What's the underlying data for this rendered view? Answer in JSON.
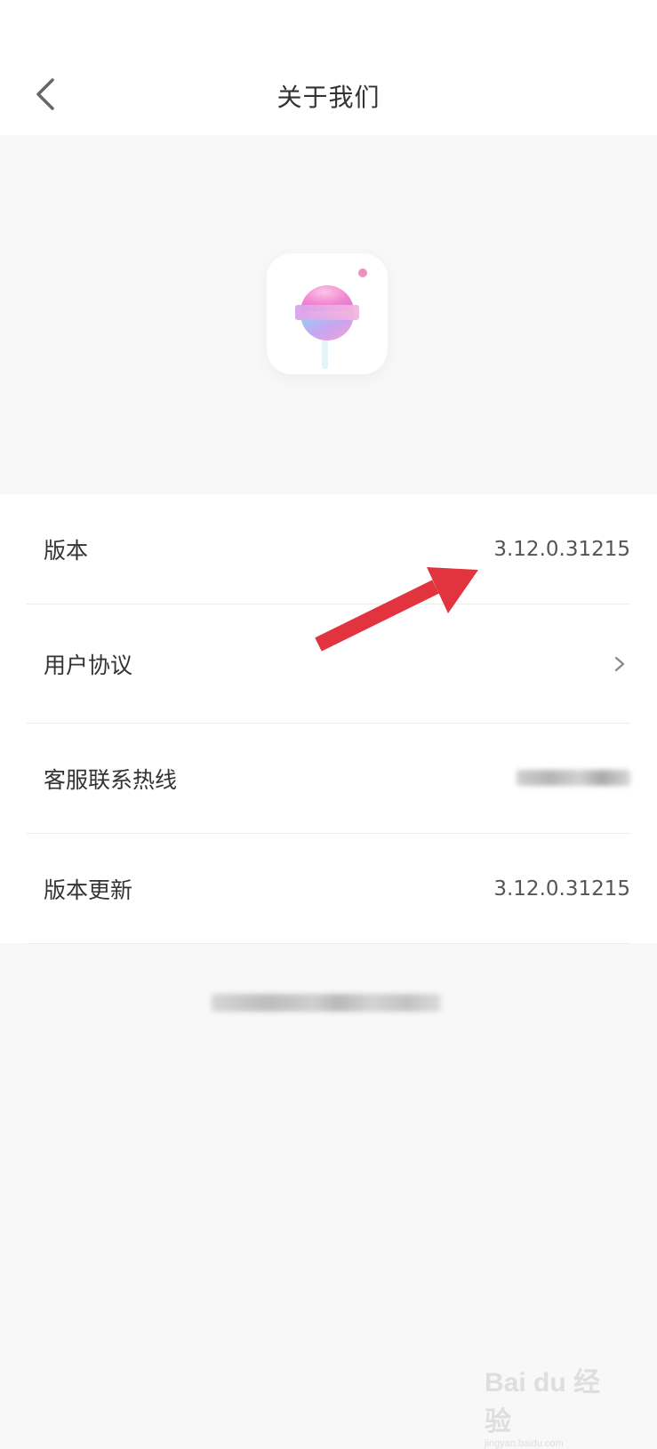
{
  "header": {
    "title": "关于我们"
  },
  "about": {
    "rows": [
      {
        "label": "版本",
        "value": "3.12.0.31215"
      },
      {
        "label": "用户协议",
        "value": ""
      },
      {
        "label": "客服联系热线",
        "value": ""
      },
      {
        "label": "版本更新",
        "value": "3.12.0.31215"
      }
    ]
  },
  "icons": {
    "back": "chevron-left-icon",
    "agreement_arrow": "chevron-right-icon",
    "app_logo": "lollipop-logo-icon",
    "annotation": "red-arrow"
  },
  "colors": {
    "background": "#f8f8f8",
    "surface": "#ffffff",
    "text_primary": "#333333",
    "annotation_arrow": "#e2343f"
  },
  "watermark": {
    "logo": "Bai du 经验",
    "url": "jingyan.baidu.com"
  }
}
